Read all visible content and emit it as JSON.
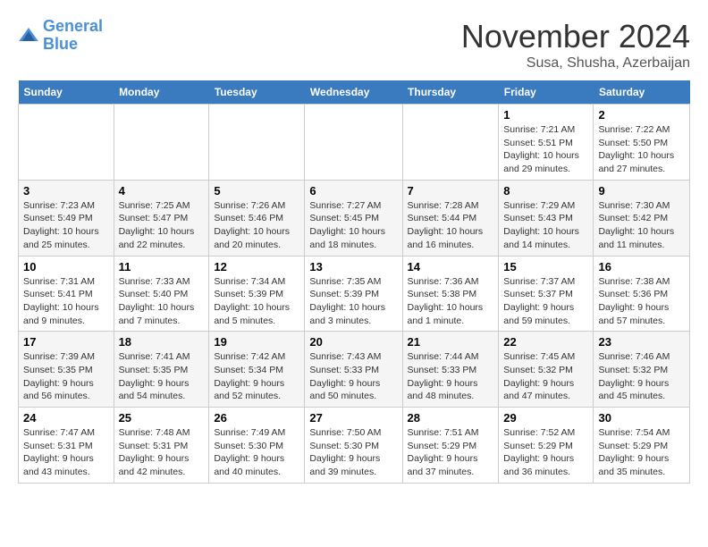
{
  "logo": {
    "line1": "General",
    "line2": "Blue"
  },
  "title": "November 2024",
  "location": "Susa, Shusha, Azerbaijan",
  "days_of_week": [
    "Sunday",
    "Monday",
    "Tuesday",
    "Wednesday",
    "Thursday",
    "Friday",
    "Saturday"
  ],
  "weeks": [
    [
      {
        "day": "",
        "info": ""
      },
      {
        "day": "",
        "info": ""
      },
      {
        "day": "",
        "info": ""
      },
      {
        "day": "",
        "info": ""
      },
      {
        "day": "",
        "info": ""
      },
      {
        "day": "1",
        "info": "Sunrise: 7:21 AM\nSunset: 5:51 PM\nDaylight: 10 hours\nand 29 minutes."
      },
      {
        "day": "2",
        "info": "Sunrise: 7:22 AM\nSunset: 5:50 PM\nDaylight: 10 hours\nand 27 minutes."
      }
    ],
    [
      {
        "day": "3",
        "info": "Sunrise: 7:23 AM\nSunset: 5:49 PM\nDaylight: 10 hours\nand 25 minutes."
      },
      {
        "day": "4",
        "info": "Sunrise: 7:25 AM\nSunset: 5:47 PM\nDaylight: 10 hours\nand 22 minutes."
      },
      {
        "day": "5",
        "info": "Sunrise: 7:26 AM\nSunset: 5:46 PM\nDaylight: 10 hours\nand 20 minutes."
      },
      {
        "day": "6",
        "info": "Sunrise: 7:27 AM\nSunset: 5:45 PM\nDaylight: 10 hours\nand 18 minutes."
      },
      {
        "day": "7",
        "info": "Sunrise: 7:28 AM\nSunset: 5:44 PM\nDaylight: 10 hours\nand 16 minutes."
      },
      {
        "day": "8",
        "info": "Sunrise: 7:29 AM\nSunset: 5:43 PM\nDaylight: 10 hours\nand 14 minutes."
      },
      {
        "day": "9",
        "info": "Sunrise: 7:30 AM\nSunset: 5:42 PM\nDaylight: 10 hours\nand 11 minutes."
      }
    ],
    [
      {
        "day": "10",
        "info": "Sunrise: 7:31 AM\nSunset: 5:41 PM\nDaylight: 10 hours\nand 9 minutes."
      },
      {
        "day": "11",
        "info": "Sunrise: 7:33 AM\nSunset: 5:40 PM\nDaylight: 10 hours\nand 7 minutes."
      },
      {
        "day": "12",
        "info": "Sunrise: 7:34 AM\nSunset: 5:39 PM\nDaylight: 10 hours\nand 5 minutes."
      },
      {
        "day": "13",
        "info": "Sunrise: 7:35 AM\nSunset: 5:39 PM\nDaylight: 10 hours\nand 3 minutes."
      },
      {
        "day": "14",
        "info": "Sunrise: 7:36 AM\nSunset: 5:38 PM\nDaylight: 10 hours\nand 1 minute."
      },
      {
        "day": "15",
        "info": "Sunrise: 7:37 AM\nSunset: 5:37 PM\nDaylight: 9 hours\nand 59 minutes."
      },
      {
        "day": "16",
        "info": "Sunrise: 7:38 AM\nSunset: 5:36 PM\nDaylight: 9 hours\nand 57 minutes."
      }
    ],
    [
      {
        "day": "17",
        "info": "Sunrise: 7:39 AM\nSunset: 5:35 PM\nDaylight: 9 hours\nand 56 minutes."
      },
      {
        "day": "18",
        "info": "Sunrise: 7:41 AM\nSunset: 5:35 PM\nDaylight: 9 hours\nand 54 minutes."
      },
      {
        "day": "19",
        "info": "Sunrise: 7:42 AM\nSunset: 5:34 PM\nDaylight: 9 hours\nand 52 minutes."
      },
      {
        "day": "20",
        "info": "Sunrise: 7:43 AM\nSunset: 5:33 PM\nDaylight: 9 hours\nand 50 minutes."
      },
      {
        "day": "21",
        "info": "Sunrise: 7:44 AM\nSunset: 5:33 PM\nDaylight: 9 hours\nand 48 minutes."
      },
      {
        "day": "22",
        "info": "Sunrise: 7:45 AM\nSunset: 5:32 PM\nDaylight: 9 hours\nand 47 minutes."
      },
      {
        "day": "23",
        "info": "Sunrise: 7:46 AM\nSunset: 5:32 PM\nDaylight: 9 hours\nand 45 minutes."
      }
    ],
    [
      {
        "day": "24",
        "info": "Sunrise: 7:47 AM\nSunset: 5:31 PM\nDaylight: 9 hours\nand 43 minutes."
      },
      {
        "day": "25",
        "info": "Sunrise: 7:48 AM\nSunset: 5:31 PM\nDaylight: 9 hours\nand 42 minutes."
      },
      {
        "day": "26",
        "info": "Sunrise: 7:49 AM\nSunset: 5:30 PM\nDaylight: 9 hours\nand 40 minutes."
      },
      {
        "day": "27",
        "info": "Sunrise: 7:50 AM\nSunset: 5:30 PM\nDaylight: 9 hours\nand 39 minutes."
      },
      {
        "day": "28",
        "info": "Sunrise: 7:51 AM\nSunset: 5:29 PM\nDaylight: 9 hours\nand 37 minutes."
      },
      {
        "day": "29",
        "info": "Sunrise: 7:52 AM\nSunset: 5:29 PM\nDaylight: 9 hours\nand 36 minutes."
      },
      {
        "day": "30",
        "info": "Sunrise: 7:54 AM\nSunset: 5:29 PM\nDaylight: 9 hours\nand 35 minutes."
      }
    ]
  ]
}
